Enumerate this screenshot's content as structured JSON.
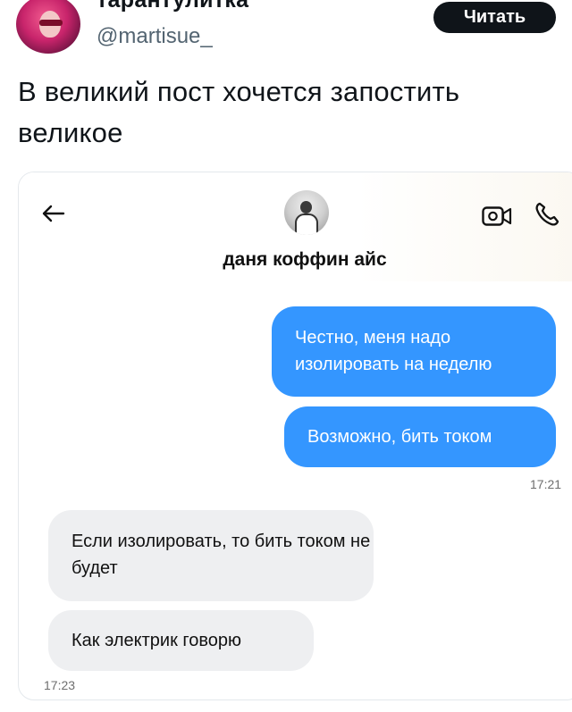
{
  "tweet": {
    "display_name": "тарантулитка",
    "handle": "@martisue_",
    "follow_button": "Читать",
    "text": "В великий пост хочется запостить великое"
  },
  "chat": {
    "contact_name": "даня коффин айс",
    "icons": {
      "back": "arrow-left-icon",
      "video": "video-call-icon",
      "phone": "phone-icon"
    },
    "messages": [
      {
        "direction": "outgoing",
        "text": "Честно, меня надо изолировать на неделю"
      },
      {
        "direction": "outgoing",
        "text": "Возможно, бить током"
      },
      {
        "direction": "incoming",
        "text": "Если изолировать, то бить током не будет"
      },
      {
        "direction": "incoming",
        "text": "Как электрик говорю"
      }
    ],
    "timestamps": {
      "outgoing": "17:21",
      "incoming": "17:23"
    },
    "colors": {
      "outgoing_bubble": "#3496ff",
      "incoming_bubble": "#eeeff1"
    }
  }
}
